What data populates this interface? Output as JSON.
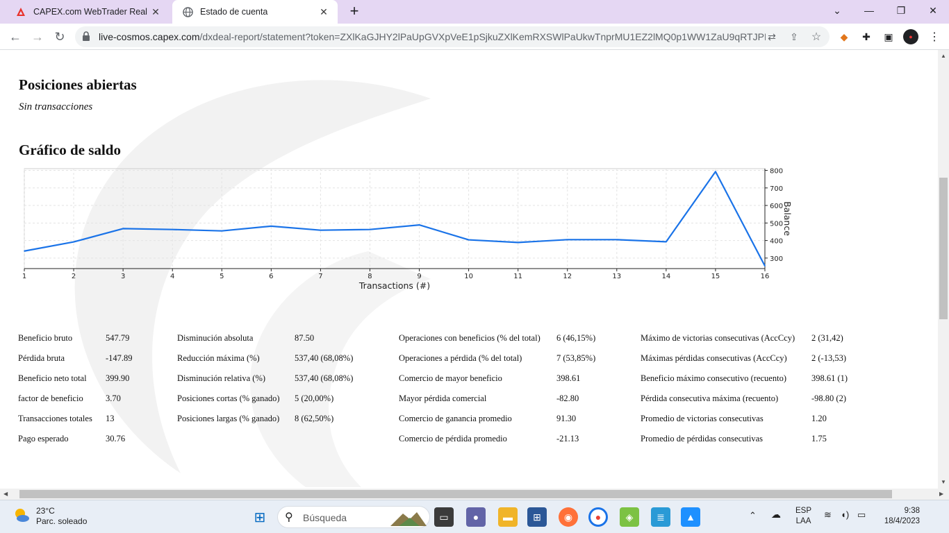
{
  "browser": {
    "tabs": [
      {
        "title": "CAPEX.com WebTrader Real",
        "active": false,
        "icon": "capex-logo-icon"
      },
      {
        "title": "Estado de cuenta",
        "active": true,
        "icon": "globe-icon"
      }
    ],
    "url_host": "live-cosmos.capex.com",
    "url_path": "/dxdeal-report/statement?token=ZXlKaGJHY2lPaUpGVXpVeE1pSjkuZXlKemRXSWlPaUkwTnprMU1EZ2lMQ0p1WW1ZaU9qRTJPRE..."
  },
  "page": {
    "open_positions": {
      "heading": "Posiciones abiertas",
      "note": "Sin transacciones"
    },
    "balance_chart": {
      "heading": "Gráfico de saldo"
    },
    "stats": {
      "col1": [
        {
          "label": "Beneficio bruto",
          "value": "547.79"
        },
        {
          "label": "Pérdida bruta",
          "value": "-147.89"
        },
        {
          "label": "Beneficio neto total",
          "value": "399.90"
        },
        {
          "label": "factor de beneficio",
          "value": "3.70"
        },
        {
          "label": "Transacciones totales",
          "value": "13"
        },
        {
          "label": "Pago esperado",
          "value": "30.76"
        }
      ],
      "col2": [
        {
          "label": "Disminución absoluta",
          "value": "87.50"
        },
        {
          "label": "Reducción máxima (%)",
          "value": "537,40 (68,08%)"
        },
        {
          "label": "Disminución relativa (%)",
          "value": "537,40 (68,08%)"
        },
        {
          "label": "Posiciones cortas (% ganado)",
          "value": "5 (20,00%)"
        },
        {
          "label": "Posiciones largas (% ganado)",
          "value": "8 (62,50%)"
        }
      ],
      "col3": [
        {
          "label": "Operaciones con beneficios (% del total)",
          "value": "6 (46,15%)"
        },
        {
          "label": "Operaciones a pérdida (% del total)",
          "value": "7 (53,85%)"
        },
        {
          "label": "Comercio de mayor beneficio",
          "value": "398.61"
        },
        {
          "label": "Mayor pérdida comercial",
          "value": "-82.80"
        },
        {
          "label": "Comercio de ganancia promedio",
          "value": "91.30"
        },
        {
          "label": "Comercio de pérdida promedio",
          "value": "-21.13"
        }
      ],
      "col4": [
        {
          "label": "Máximo de victorias consecutivas (AccCcy)",
          "value": "2 (31,42)"
        },
        {
          "label": "Máximas pérdidas consecutivas (AccCcy)",
          "value": "2 (-13,53)"
        },
        {
          "label": "Beneficio máximo consecutivo (recuento)",
          "value": "398.61 (1)"
        },
        {
          "label": "Pérdida consecutiva máxima (recuento)",
          "value": "-98.80 (2)"
        },
        {
          "label": "Promedio de victorias consecutivas",
          "value": "1.20"
        },
        {
          "label": "Promedio de pérdidas consecutivas",
          "value": "1.75"
        }
      ]
    }
  },
  "chart_data": {
    "type": "line",
    "xlabel": "Transactions (#)",
    "ylabel": "Balance",
    "x": [
      1,
      2,
      3,
      4,
      5,
      6,
      7,
      8,
      9,
      10,
      11,
      12,
      13,
      14,
      15,
      16
    ],
    "series": [
      {
        "values": [
          340,
          392,
          468,
          463,
          455,
          482,
          459,
          463,
          489,
          404,
          389,
          405,
          405,
          393,
          793,
          255
        ],
        "color": "#1a73e8"
      }
    ],
    "xlim": [
      1,
      16
    ],
    "ylim": [
      240,
      810
    ],
    "yticks": [
      300,
      400,
      500,
      600,
      700,
      800
    ],
    "grid": true,
    "y_axis_side": "right"
  },
  "taskbar": {
    "weather_temp": "23°C",
    "weather_desc": "Parc. soleado",
    "search_placeholder": "Búsqueda",
    "lang_top": "ESP",
    "lang_bottom": "LAA",
    "time": "9:38",
    "date": "18/4/2023"
  }
}
